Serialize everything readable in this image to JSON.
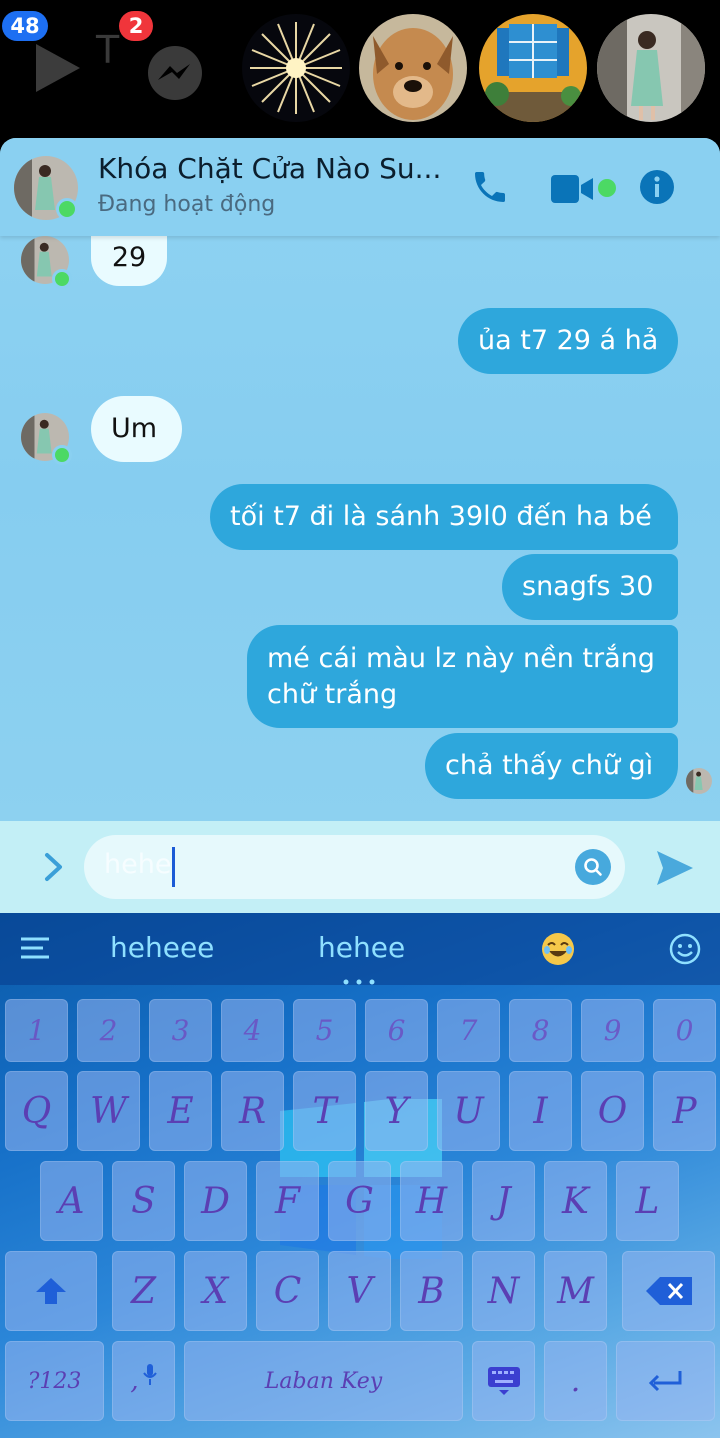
{
  "top_strip": {
    "badge_left": "48",
    "badge_messenger": "2",
    "partial_letter": "T",
    "chatheads": [
      "fireworks-avatar",
      "dog-avatar",
      "window-avatar",
      "girl-avatar"
    ]
  },
  "chat": {
    "title": "Khóa Chặt Cửa Nào Su...",
    "status": "Đang hoạt động",
    "messages": [
      {
        "dir": "in",
        "text": "29"
      },
      {
        "dir": "out",
        "text": "ủa t7 29 á hả"
      },
      {
        "dir": "in",
        "text": "Um"
      },
      {
        "dir": "out",
        "text": "tối t7 đi là sánh 39l0 đến ha bé"
      },
      {
        "dir": "out",
        "text": "snagfs 30"
      },
      {
        "dir": "out",
        "text": "mé cái màu lz này nền trắng chữ trắng"
      },
      {
        "dir": "out",
        "text": "chả thấy chữ gì"
      }
    ]
  },
  "composer": {
    "input_value": "hehe"
  },
  "keyboard": {
    "suggestions": [
      "heheee",
      "hehee"
    ],
    "numbers": [
      "1",
      "2",
      "3",
      "4",
      "5",
      "6",
      "7",
      "8",
      "9",
      "0"
    ],
    "row1": [
      "Q",
      "W",
      "E",
      "R",
      "T",
      "Y",
      "U",
      "I",
      "O",
      "P"
    ],
    "row2": [
      "A",
      "S",
      "D",
      "F",
      "G",
      "H",
      "J",
      "K",
      "L"
    ],
    "row3": [
      "Z",
      "X",
      "C",
      "V",
      "B",
      "N",
      "M"
    ],
    "symbols_label": "?123",
    "comma_label": ",",
    "space_label": "Laban Key",
    "period_label": "."
  },
  "colors": {
    "outgoing_bubble": "#2ea7dc",
    "incoming_bubble": "#e9fbff",
    "header_icon": "#0a74b8",
    "online": "#4cd964",
    "badge_blue": "#1d6ff2",
    "badge_red": "#f0353b"
  }
}
